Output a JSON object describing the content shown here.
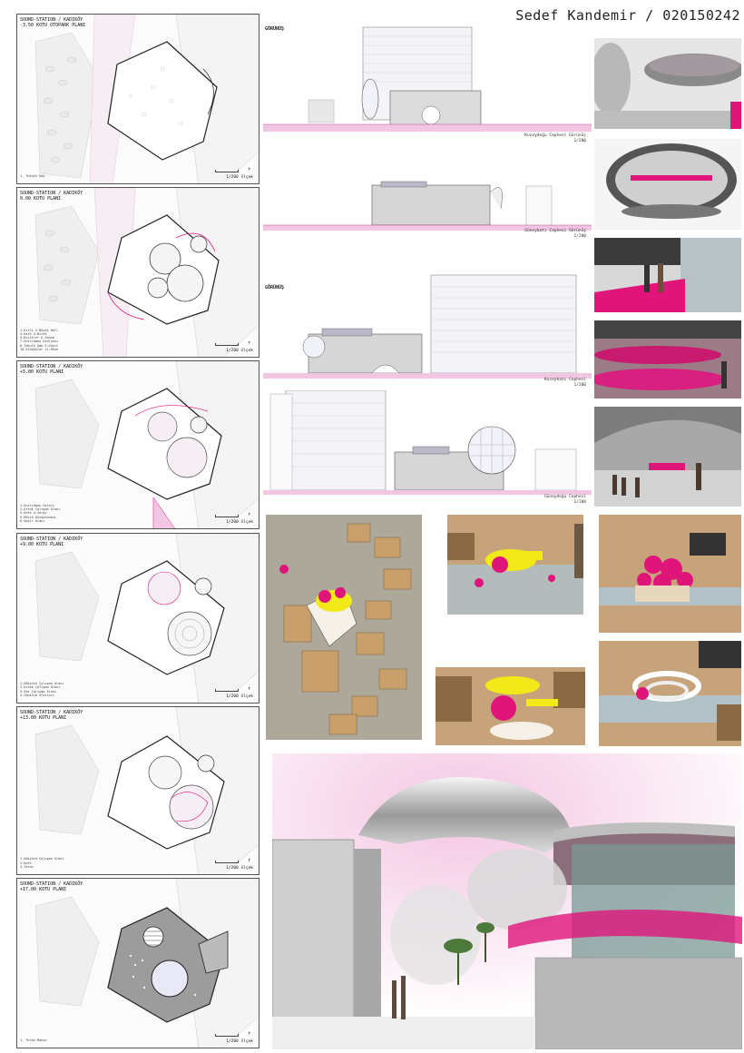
{
  "author": "Sedef Kandemir / 020150242",
  "plans": [
    {
      "title": "SOUND-STATION / KADIKÖY\n-3.50 KOTU OTOPARK PLANI",
      "scale": "1/200 ölçek",
      "legend": [
        "1- Teknik Oda"
      ]
    },
    {
      "title": "SOUND-STATION / KADIKÖY\n0.00 KOTU PLANI",
      "scale": "1/200 ölçek",
      "legend": [
        "1-Kirli 2-Büyük Holl",
        "3-Kafe 4-Bilet",
        "5-Kulisler 6-Sahne",
        "7-Enstrüman Atölyesi",
        "8-Teknik Oda 9-Kayıt",
        "10-Stüdyolar 11-Müze"
      ]
    },
    {
      "title": "SOUND-STATION / KADIKÖY\n+5.00 KOTU PLANI",
      "scale": "1/200 ölçek",
      "legend": [
        "1-Enstrüman Galeri",
        "2-Ortak Çalışma Alanı",
        "3-Kafe 4-Sergi",
        "5-Müzik Kütüphanesi",
        "6-Seyir Alanı"
      ]
    },
    {
      "title": "SOUND-STATION / KADIKÖY\n+9.00 KOTU PLANI",
      "scale": "1/200 ölçek",
      "legend": [
        "1-Gökyüzü Çalışma Alanı",
        "2-Ortak Çalışma Alanı",
        "3-Ses Çalışma Alanı",
        "4-Yönetim Ofisleri"
      ]
    },
    {
      "title": "SOUND-STATION / KADIKÖY\n+13.00 KOTU PLANI",
      "scale": "1/200 ölçek",
      "legend": [
        "1-Gökyüzü Çalışma Alanı",
        "2-Kafe",
        "3-Teras"
      ]
    },
    {
      "title": "SOUND-STATION / KADIKÖY\n+17.00 KOTU PLANI",
      "scale": "1/200 ölçek",
      "legend": [
        "1- Teras Bahçe"
      ]
    }
  ],
  "elevations": [
    {
      "heading": "GÖRÜNÜŞ",
      "caption": "Kuzeydoğu Cephesi Görünüş\n1/200"
    },
    {
      "heading": "",
      "caption": "Güneybatı Cephesi Görünüş\n1/200"
    },
    {
      "heading": "GÖRÜNÜŞ",
      "caption": "Kuzeybatı Cephesi\n1/200"
    },
    {
      "heading": "",
      "caption": "Güneydoğu Cephesi\n1/200"
    }
  ],
  "colors": {
    "accent": "#e0157a",
    "accent_light": "#f3c7e4",
    "cardboard": "#b08a5a",
    "water": "#a9cde6",
    "model_yellow": "#f2ea18",
    "concrete": "#9a9a9a"
  }
}
